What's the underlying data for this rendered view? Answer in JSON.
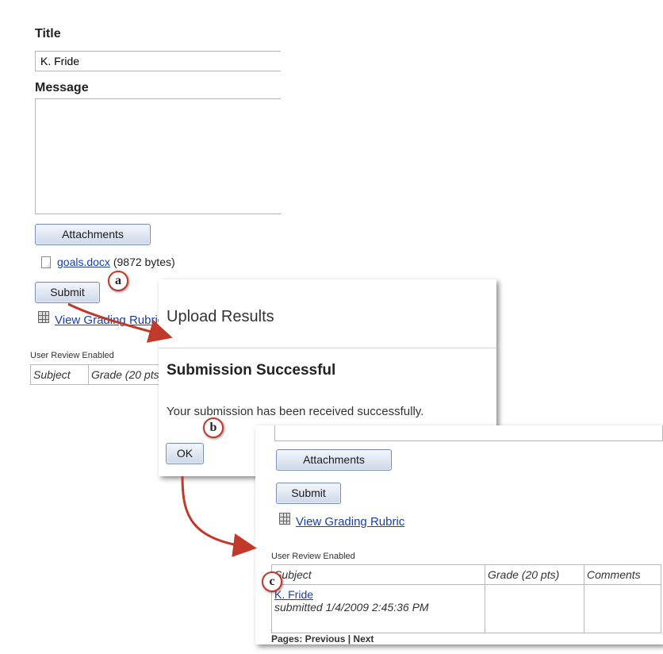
{
  "form": {
    "title_label": "Title",
    "title_value": "K. Fride",
    "message_label": "Message",
    "attachments_button": "Attachments",
    "file_name": "goals.docx",
    "file_size": "(9872 bytes)",
    "submit_button": "Submit",
    "rubric_link": "View Grading Rubric",
    "review_enabled": "User Review Enabled",
    "table_headers": [
      "Subject",
      "Grade (20 pts)"
    ]
  },
  "dialog": {
    "title": "Upload Results",
    "heading": "Submission Successful",
    "message": "Your submission has been received successfully.",
    "ok_button": "OK"
  },
  "result": {
    "attachments_button": "Attachments",
    "submit_button": "Submit",
    "rubric_link": "View Grading Rubric",
    "review_enabled": "User Review Enabled",
    "table_headers": [
      "Subject",
      "Grade (20 pts)",
      "Comments"
    ],
    "row": {
      "name": "K. Fride",
      "submitted": "submitted 1/4/2009 2:45:36 PM"
    },
    "pager": "Pages: Previous | Next"
  },
  "callouts": [
    "a",
    "b",
    "c"
  ],
  "colors": {
    "arrow": "#c0392b",
    "link": "#1a3fa6",
    "button_border": "#7a8fb0"
  }
}
